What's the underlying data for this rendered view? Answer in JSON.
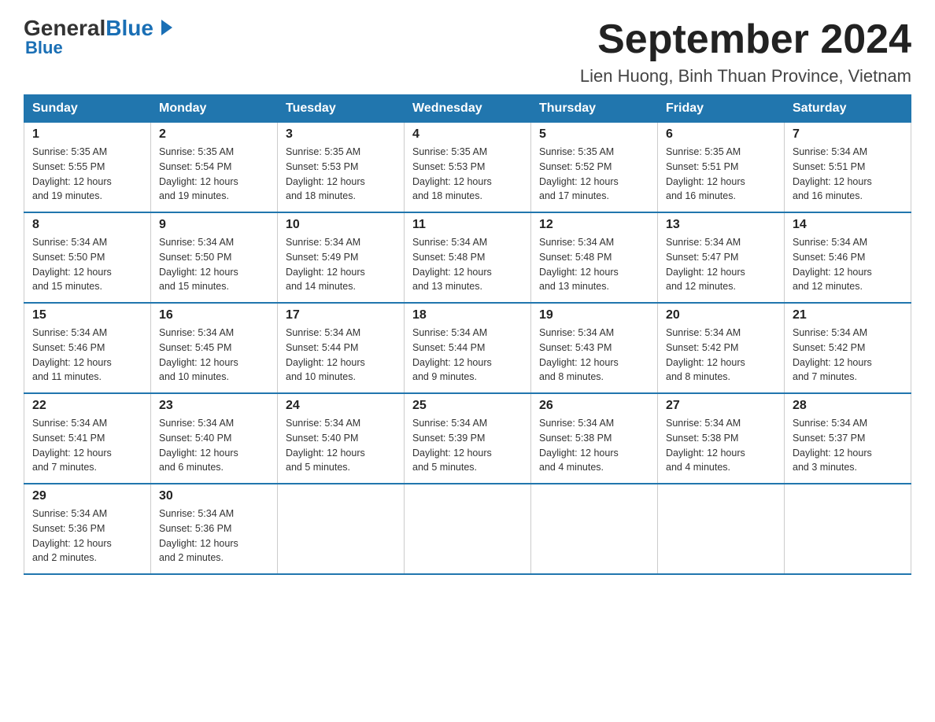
{
  "logo": {
    "general": "General",
    "blue": "Blue"
  },
  "title": "September 2024",
  "subtitle": "Lien Huong, Binh Thuan Province, Vietnam",
  "days_of_week": [
    "Sunday",
    "Monday",
    "Tuesday",
    "Wednesday",
    "Thursday",
    "Friday",
    "Saturday"
  ],
  "weeks": [
    [
      {
        "day": "1",
        "sunrise": "5:35 AM",
        "sunset": "5:55 PM",
        "daylight": "12 hours and 19 minutes."
      },
      {
        "day": "2",
        "sunrise": "5:35 AM",
        "sunset": "5:54 PM",
        "daylight": "12 hours and 19 minutes."
      },
      {
        "day": "3",
        "sunrise": "5:35 AM",
        "sunset": "5:53 PM",
        "daylight": "12 hours and 18 minutes."
      },
      {
        "day": "4",
        "sunrise": "5:35 AM",
        "sunset": "5:53 PM",
        "daylight": "12 hours and 18 minutes."
      },
      {
        "day": "5",
        "sunrise": "5:35 AM",
        "sunset": "5:52 PM",
        "daylight": "12 hours and 17 minutes."
      },
      {
        "day": "6",
        "sunrise": "5:35 AM",
        "sunset": "5:51 PM",
        "daylight": "12 hours and 16 minutes."
      },
      {
        "day": "7",
        "sunrise": "5:34 AM",
        "sunset": "5:51 PM",
        "daylight": "12 hours and 16 minutes."
      }
    ],
    [
      {
        "day": "8",
        "sunrise": "5:34 AM",
        "sunset": "5:50 PM",
        "daylight": "12 hours and 15 minutes."
      },
      {
        "day": "9",
        "sunrise": "5:34 AM",
        "sunset": "5:50 PM",
        "daylight": "12 hours and 15 minutes."
      },
      {
        "day": "10",
        "sunrise": "5:34 AM",
        "sunset": "5:49 PM",
        "daylight": "12 hours and 14 minutes."
      },
      {
        "day": "11",
        "sunrise": "5:34 AM",
        "sunset": "5:48 PM",
        "daylight": "12 hours and 13 minutes."
      },
      {
        "day": "12",
        "sunrise": "5:34 AM",
        "sunset": "5:48 PM",
        "daylight": "12 hours and 13 minutes."
      },
      {
        "day": "13",
        "sunrise": "5:34 AM",
        "sunset": "5:47 PM",
        "daylight": "12 hours and 12 minutes."
      },
      {
        "day": "14",
        "sunrise": "5:34 AM",
        "sunset": "5:46 PM",
        "daylight": "12 hours and 12 minutes."
      }
    ],
    [
      {
        "day": "15",
        "sunrise": "5:34 AM",
        "sunset": "5:46 PM",
        "daylight": "12 hours and 11 minutes."
      },
      {
        "day": "16",
        "sunrise": "5:34 AM",
        "sunset": "5:45 PM",
        "daylight": "12 hours and 10 minutes."
      },
      {
        "day": "17",
        "sunrise": "5:34 AM",
        "sunset": "5:44 PM",
        "daylight": "12 hours and 10 minutes."
      },
      {
        "day": "18",
        "sunrise": "5:34 AM",
        "sunset": "5:44 PM",
        "daylight": "12 hours and 9 minutes."
      },
      {
        "day": "19",
        "sunrise": "5:34 AM",
        "sunset": "5:43 PM",
        "daylight": "12 hours and 8 minutes."
      },
      {
        "day": "20",
        "sunrise": "5:34 AM",
        "sunset": "5:42 PM",
        "daylight": "12 hours and 8 minutes."
      },
      {
        "day": "21",
        "sunrise": "5:34 AM",
        "sunset": "5:42 PM",
        "daylight": "12 hours and 7 minutes."
      }
    ],
    [
      {
        "day": "22",
        "sunrise": "5:34 AM",
        "sunset": "5:41 PM",
        "daylight": "12 hours and 7 minutes."
      },
      {
        "day": "23",
        "sunrise": "5:34 AM",
        "sunset": "5:40 PM",
        "daylight": "12 hours and 6 minutes."
      },
      {
        "day": "24",
        "sunrise": "5:34 AM",
        "sunset": "5:40 PM",
        "daylight": "12 hours and 5 minutes."
      },
      {
        "day": "25",
        "sunrise": "5:34 AM",
        "sunset": "5:39 PM",
        "daylight": "12 hours and 5 minutes."
      },
      {
        "day": "26",
        "sunrise": "5:34 AM",
        "sunset": "5:38 PM",
        "daylight": "12 hours and 4 minutes."
      },
      {
        "day": "27",
        "sunrise": "5:34 AM",
        "sunset": "5:38 PM",
        "daylight": "12 hours and 4 minutes."
      },
      {
        "day": "28",
        "sunrise": "5:34 AM",
        "sunset": "5:37 PM",
        "daylight": "12 hours and 3 minutes."
      }
    ],
    [
      {
        "day": "29",
        "sunrise": "5:34 AM",
        "sunset": "5:36 PM",
        "daylight": "12 hours and 2 minutes."
      },
      {
        "day": "30",
        "sunrise": "5:34 AM",
        "sunset": "5:36 PM",
        "daylight": "12 hours and 2 minutes."
      },
      null,
      null,
      null,
      null,
      null
    ]
  ],
  "labels": {
    "sunrise": "Sunrise:",
    "sunset": "Sunset:",
    "daylight": "Daylight:"
  }
}
